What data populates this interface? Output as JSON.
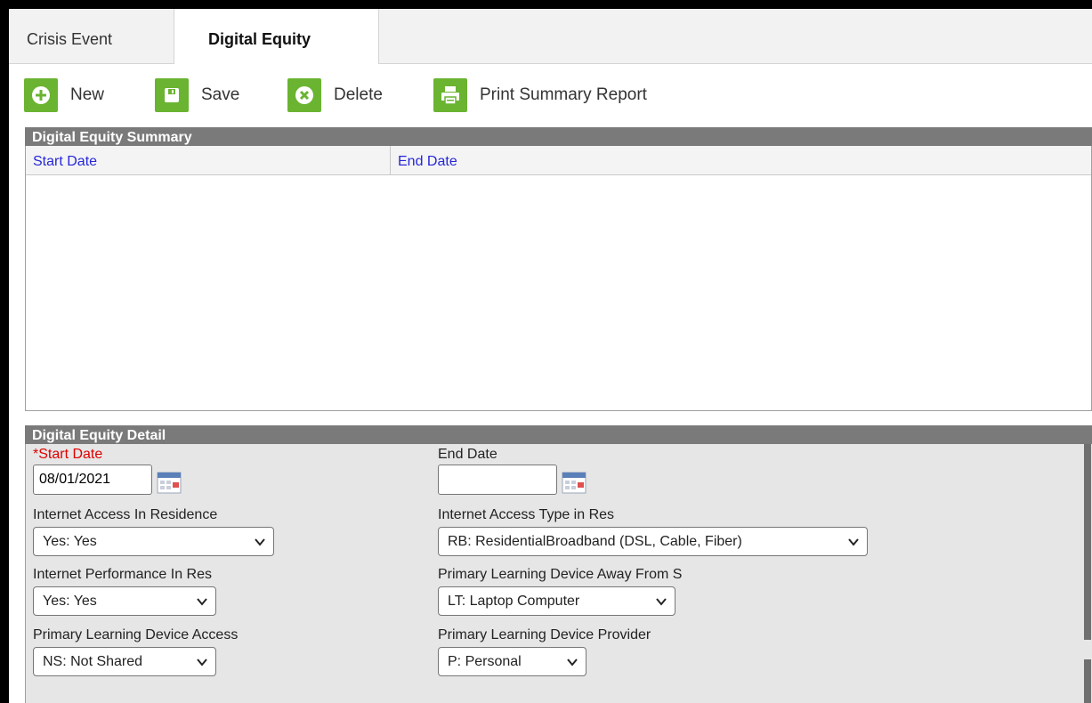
{
  "tabs": [
    {
      "label": "Crisis Event",
      "active": false
    },
    {
      "label": "Digital Equity",
      "active": true
    }
  ],
  "toolbar": {
    "new_label": "New",
    "save_label": "Save",
    "delete_label": "Delete",
    "print_label": "Print Summary Report",
    "icons": [
      "plus-icon",
      "save-icon",
      "delete-icon",
      "printer-icon"
    ],
    "accent_color": "#6ab431"
  },
  "summary": {
    "title": "Digital Equity Summary",
    "columns": [
      "Start Date",
      "End Date"
    ],
    "rows": []
  },
  "detail": {
    "title": "Digital Equity Detail",
    "start_date": {
      "label": "Start Date",
      "required_marker": "*",
      "value": "08/01/2021"
    },
    "end_date": {
      "label": "End Date",
      "value": ""
    },
    "internet_access": {
      "label": "Internet Access In Residence",
      "value": "Yes: Yes"
    },
    "internet_access_type": {
      "label": "Internet Access Type in Res",
      "value": "RB: ResidentialBroadband (DSL, Cable, Fiber)"
    },
    "internet_performance": {
      "label": "Internet Performance In Res",
      "value": "Yes: Yes"
    },
    "device_away": {
      "label": "Primary Learning Device Away From S",
      "value": "LT: Laptop Computer"
    },
    "device_access": {
      "label": "Primary Learning Device Access",
      "value": "NS: Not Shared"
    },
    "device_provider": {
      "label": "Primary Learning Device Provider",
      "value": "P: Personal"
    }
  }
}
